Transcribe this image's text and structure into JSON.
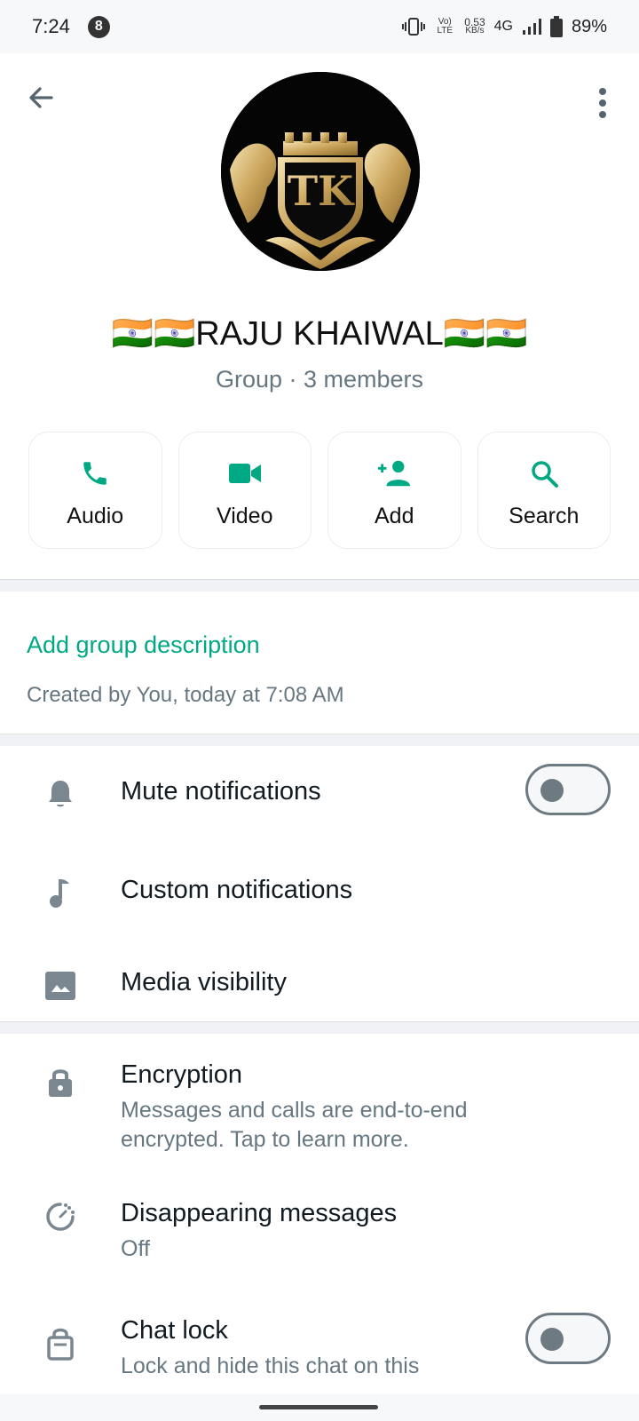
{
  "status_bar": {
    "time": "7:24",
    "notification_count": "8",
    "volte": "VoLTE",
    "speed_value": "0.53",
    "speed_unit": "KB/s",
    "network": "4G",
    "battery": "89%"
  },
  "header": {
    "avatar_initials": "TK",
    "group_name": "🇮🇳🇮🇳RAJU KHAIWAL🇮🇳🇮🇳",
    "group_subtitle": "Group · 3 members"
  },
  "actions": [
    {
      "label": "Audio",
      "icon": "phone-icon"
    },
    {
      "label": "Video",
      "icon": "video-icon"
    },
    {
      "label": "Add",
      "icon": "add-person-icon"
    },
    {
      "label": "Search",
      "icon": "search-icon"
    }
  ],
  "description": {
    "add_label": "Add group description",
    "created_text": "Created by You, today at 7:08 AM"
  },
  "settings": {
    "mute": {
      "title": "Mute notifications",
      "enabled": false
    },
    "custom": {
      "title": "Custom notifications"
    },
    "media": {
      "title": "Media visibility"
    }
  },
  "privacy": {
    "encryption": {
      "title": "Encryption",
      "subtitle": "Messages and calls are end-to-end encrypted. Tap to learn more."
    },
    "disappearing": {
      "title": "Disappearing messages",
      "subtitle": "Off"
    },
    "chat_lock": {
      "title": "Chat lock",
      "subtitle": "Lock and hide this chat on this",
      "enabled": false
    }
  },
  "colors": {
    "accent": "#00a884",
    "icon_gray": "#7b8790"
  }
}
